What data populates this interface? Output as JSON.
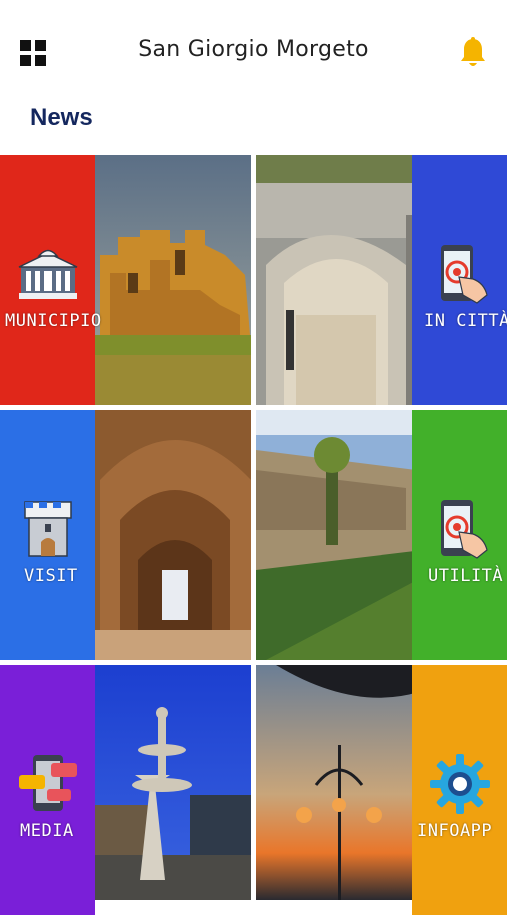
{
  "header": {
    "title": "San Giorgio Morgeto",
    "menu_icon": "grid-menu-icon",
    "notification_icon": "bell-icon"
  },
  "news_heading": "News",
  "tiles": [
    {
      "label": "MUNICIPIO",
      "icon": "town-hall-icon",
      "band_color": "#e0271a"
    },
    {
      "label": "IN CITTÀ",
      "icon": "touch-phone-icon",
      "band_color": "#2f49d6"
    },
    {
      "label": "VISIT",
      "icon": "tower-icon",
      "band_color": "#2b6fe6"
    },
    {
      "label": "UTILITÀ",
      "icon": "touch-phone-icon",
      "band_color": "#42b02a"
    },
    {
      "label": "MEDIA",
      "icon": "chat-phone-icon",
      "band_color": "#7a1fd8"
    },
    {
      "label": "INFOAPP",
      "icon": "gear-icon",
      "band_color": "#f0a10f"
    }
  ],
  "colors": {
    "news_heading": "#14275e",
    "bell": "#f5b400"
  }
}
